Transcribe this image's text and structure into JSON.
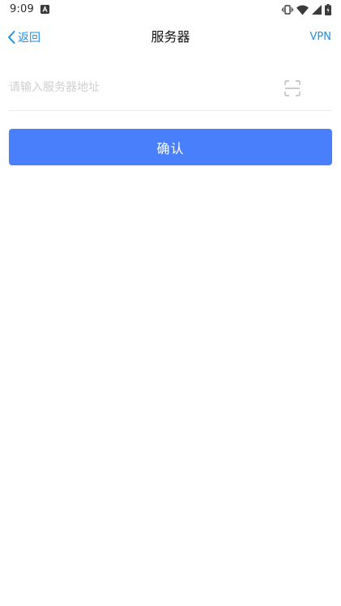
{
  "status_bar": {
    "time": "9:09",
    "notification_icon": "a-letter-icon",
    "icons": [
      "vibrate-icon",
      "wifi-icon",
      "cellular-signal-icon",
      "battery-icon"
    ]
  },
  "nav": {
    "back_label": "返回",
    "title": "服务器",
    "right_action_label": "VPN"
  },
  "form": {
    "server_input_placeholder": "请输入服务器地址",
    "server_input_value": "",
    "confirm_label": "确认"
  },
  "colors": {
    "accent": "#1f8fe6",
    "primary_button": "#4a7ffc",
    "placeholder": "#cfcfcf",
    "divider": "#ececec"
  }
}
